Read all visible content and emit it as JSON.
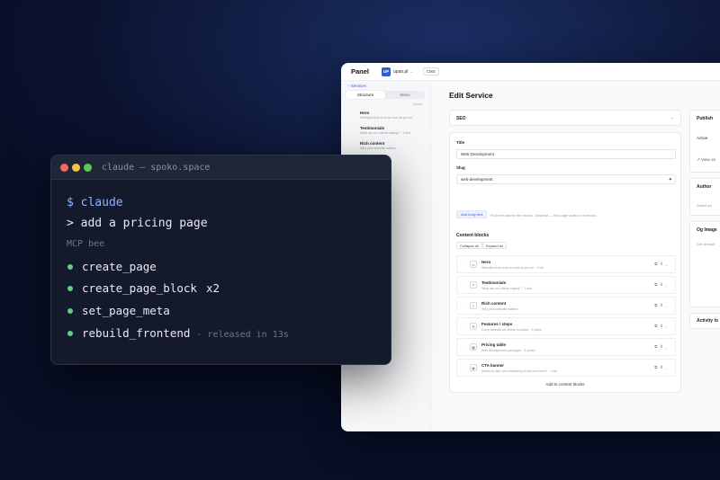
{
  "panel": {
    "brand": "Panel",
    "site_badge": "UP",
    "site_name": "upan.pl",
    "cms_pill": "CMS",
    "sidebar": {
      "back_label": "‹  Services",
      "tabs": [
        {
          "label": "Structure",
          "active": true
        },
        {
          "label": "Menu",
          "active": false
        }
      ],
      "count": "6 items",
      "items": [
        {
          "title": "Hero",
          "subtitle": "Websites that work as hard as you do"
        },
        {
          "title": "Testimonials",
          "subtitle": "What are our clients saying? · 1 text"
        },
        {
          "title": "Rich content",
          "subtitle": "Why your website matters"
        },
        {
          "title": "",
          "subtitle": "Every website we deliver includes"
        },
        {
          "title": "",
          "subtitle": "Web development packages · 3 prices"
        },
        {
          "title": "",
          "subtitle": "Ready to take your marketing to the"
        }
      ]
    },
    "page_title": "Edit Service",
    "seo_label": "SEO",
    "title_label": "Title",
    "title_value": "Web Development",
    "slug_label": "Slug",
    "slug_value": "web-development",
    "add_body_text": "Add body text",
    "add_body_hint": "Rich text above the blocks. Optional — this page authors in blocks.",
    "content_blocks_title": "Content blocks",
    "collapse_all": "Collapse all",
    "expand_all": "Expand all",
    "blocks": [
      {
        "title": "Hero",
        "subtitle": "Websites that work as hard as you do · 1 tile",
        "icon": "layout-icon"
      },
      {
        "title": "Testimonials",
        "subtitle": "What are our clients saying? · 1 text",
        "icon": "quote-icon"
      },
      {
        "title": "Rich content",
        "subtitle": "Why your website matters",
        "icon": "text-icon"
      },
      {
        "title": "Features / steps",
        "subtitle": "Every website we deliver includes · 6 steps",
        "icon": "list-icon"
      },
      {
        "title": "Pricing table",
        "subtitle": "Web development packages · 3 prices",
        "icon": "table-icon"
      },
      {
        "title": "CTA banner",
        "subtitle": "Ready to take your marketing to the next level? · 1 tile",
        "icon": "megaphone-icon"
      }
    ],
    "add_to_blocks": "Add to content blocks",
    "right": {
      "publish_title": "Publish",
      "status": "Active",
      "view_link": "View on",
      "author_title": "Author",
      "author_placeholder": "Select an",
      "og_title": "Og Image",
      "og_hint": "Site default",
      "activity_title": "Activity lo"
    }
  },
  "terminal": {
    "title": "claude — spoko.space",
    "prompt": "$ claude",
    "command": "> add a pricing page",
    "mcp_line": "MCP  bee",
    "tools": [
      {
        "name": "create_page",
        "suffix": "",
        "note": ""
      },
      {
        "name": "create_page_block",
        "suffix": "x2",
        "note": ""
      },
      {
        "name": "set_page_meta",
        "suffix": "",
        "note": ""
      },
      {
        "name": "rebuild_frontend",
        "suffix": "",
        "note": "· released in 13s"
      }
    ],
    "colors": {
      "bullet": "#5fd17a",
      "prompt": "#8fb3ff",
      "background": "#141a2b"
    }
  }
}
